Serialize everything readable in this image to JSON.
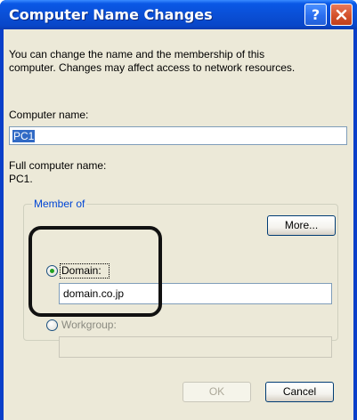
{
  "window": {
    "title": "Computer Name Changes",
    "help_glyph": "?",
    "close_icon": "close-icon"
  },
  "description": {
    "line1": "You can change the name and the membership of this",
    "line2": "computer. Changes may affect access to network resources."
  },
  "computer_name": {
    "label": "Computer name:",
    "value": "PC1"
  },
  "full_name": {
    "label": "Full computer name:",
    "value": "PC1."
  },
  "more_button": {
    "label": "More..."
  },
  "member_of": {
    "legend": "Member of",
    "domain": {
      "label": "Domain:",
      "value": "domain.co.jp",
      "selected": true
    },
    "workgroup": {
      "label": "Workgroup:",
      "value": "",
      "selected": false
    }
  },
  "buttons": {
    "ok": {
      "label": "OK",
      "enabled": false
    },
    "cancel": {
      "label": "Cancel",
      "enabled": true
    }
  },
  "colors": {
    "title_bar": "#0a4fd6",
    "dialog_face": "#ece9d8",
    "group_legend": "#0046d5",
    "radio_dot": "#21a121",
    "selection": "#316ac5"
  }
}
